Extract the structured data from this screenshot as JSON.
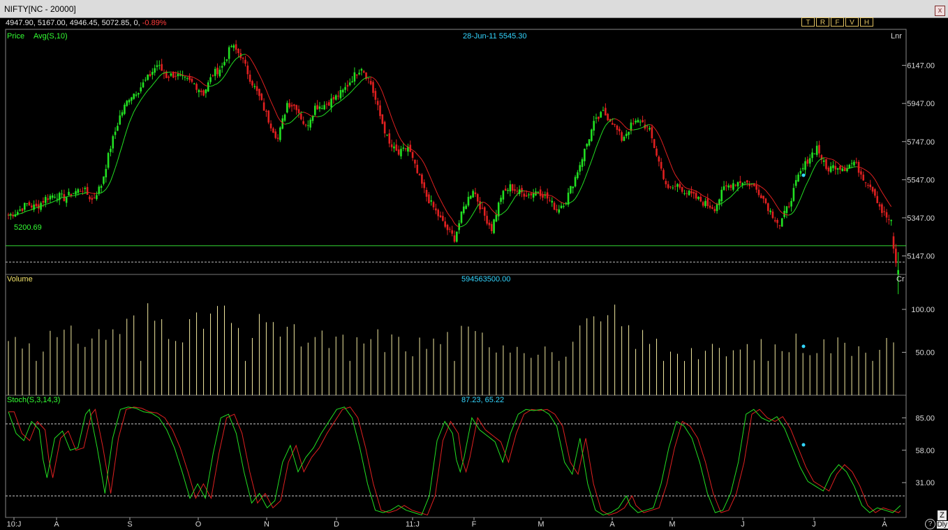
{
  "window": {
    "title": "NIFTY[NC - 20000]",
    "close_label": "x"
  },
  "quote": {
    "values": "4947.90, 5167.00, 4946.45, 5072.85, 0, ",
    "change": "-0.89%"
  },
  "toolbar": {
    "buttons": [
      "T",
      "R",
      "F",
      "V",
      "H"
    ]
  },
  "price_panel": {
    "label_price": "Price",
    "label_avg": "Avg(S,10)",
    "crosshair_readout": "28-Jun-11 5545.30",
    "scale_mode": "Lnr",
    "support_line_label": "5200.69"
  },
  "volume_panel": {
    "label": "Volume",
    "readout": "594563500.00",
    "unit": "Cr"
  },
  "stoch_panel": {
    "label": "Stoch(S,3,14,3)",
    "readout": "87.23, 65.22"
  },
  "misc": {
    "z_label": "Z",
    "dly_label": "Dly",
    "help_label": "?"
  },
  "colors": {
    "up": "#22e022",
    "down": "#e02020",
    "avg": "#22e022",
    "volume": "#f3eaa0",
    "stoch_k": "#22e022",
    "stoch_d": "#e02020"
  },
  "chart_data": [
    {
      "type": "candlestick",
      "title": "Price",
      "x_tick_labels": [
        "10:J",
        "A",
        "S",
        "O",
        "N",
        "D",
        "11:J",
        "F",
        "M",
        "A",
        "M",
        "J",
        "J",
        "A"
      ],
      "y_tick_labels": [
        "6147.00",
        "5947.00",
        "5747.00",
        "5547.00",
        "5347.00",
        "5147.00"
      ],
      "ylim": [
        5050,
        6270
      ],
      "support_level": 5200.69,
      "dashed_level": 5115,
      "close_path": [
        [
          0,
          5360
        ],
        [
          4,
          5380
        ],
        [
          8,
          5420
        ],
        [
          12,
          5400
        ],
        [
          16,
          5450
        ],
        [
          20,
          5470
        ],
        [
          24,
          5450
        ],
        [
          28,
          5480
        ],
        [
          32,
          5500
        ],
        [
          36,
          5440
        ],
        [
          40,
          5520
        ],
        [
          44,
          5720
        ],
        [
          48,
          5880
        ],
        [
          52,
          5980
        ],
        [
          56,
          6020
        ],
        [
          60,
          6080
        ],
        [
          64,
          6150
        ],
        [
          68,
          6090
        ],
        [
          72,
          6100
        ],
        [
          76,
          6070
        ],
        [
          80,
          6050
        ],
        [
          84,
          6000
        ],
        [
          88,
          6100
        ],
        [
          92,
          6140
        ],
        [
          96,
          6250
        ],
        [
          100,
          6200
        ],
        [
          104,
          6080
        ],
        [
          108,
          5980
        ],
        [
          112,
          5860
        ],
        [
          116,
          5760
        ],
        [
          120,
          5950
        ],
        [
          124,
          5930
        ],
        [
          128,
          5820
        ],
        [
          132,
          5930
        ],
        [
          136,
          5940
        ],
        [
          140,
          5970
        ],
        [
          144,
          6010
        ],
        [
          148,
          6080
        ],
        [
          152,
          6140
        ],
        [
          156,
          6050
        ],
        [
          160,
          5880
        ],
        [
          164,
          5730
        ],
        [
          168,
          5680
        ],
        [
          172,
          5720
        ],
        [
          176,
          5580
        ],
        [
          180,
          5460
        ],
        [
          184,
          5380
        ],
        [
          188,
          5300
        ],
        [
          192,
          5240
        ],
        [
          196,
          5400
        ],
        [
          200,
          5500
        ],
        [
          204,
          5380
        ],
        [
          208,
          5290
        ],
        [
          212,
          5460
        ],
        [
          216,
          5510
        ],
        [
          220,
          5480
        ],
        [
          224,
          5470
        ],
        [
          228,
          5490
        ],
        [
          232,
          5450
        ],
        [
          236,
          5390
        ],
        [
          240,
          5440
        ],
        [
          244,
          5560
        ],
        [
          248,
          5700
        ],
        [
          252,
          5840
        ],
        [
          256,
          5900
        ],
        [
          260,
          5850
        ],
        [
          264,
          5760
        ],
        [
          268,
          5830
        ],
        [
          272,
          5860
        ],
        [
          276,
          5800
        ],
        [
          280,
          5640
        ],
        [
          284,
          5490
        ],
        [
          288,
          5520
        ],
        [
          292,
          5480
        ],
        [
          296,
          5450
        ],
        [
          300,
          5420
        ],
        [
          304,
          5400
        ],
        [
          308,
          5500
        ],
        [
          312,
          5530
        ],
        [
          316,
          5540
        ],
        [
          320,
          5520
        ],
        [
          324,
          5470
        ],
        [
          328,
          5380
        ],
        [
          332,
          5310
        ],
        [
          336,
          5420
        ],
        [
          340,
          5560
        ],
        [
          344,
          5650
        ],
        [
          348,
          5720
        ],
        [
          352,
          5600
        ],
        [
          356,
          5620
        ],
        [
          360,
          5610
        ],
        [
          364,
          5640
        ],
        [
          368,
          5560
        ],
        [
          372,
          5500
        ],
        [
          376,
          5380
        ],
        [
          380,
          5320
        ]
      ],
      "last_bars": [
        {
          "open": 5250,
          "high": 5270,
          "low": 5160,
          "close": 5185
        },
        {
          "open": 5185,
          "high": 5210,
          "low": 5090,
          "close": 5110
        },
        {
          "open": 5050,
          "high": 5167.0,
          "low": 4946.45,
          "close": 5072.85
        }
      ]
    },
    {
      "type": "bar",
      "title": "Volume",
      "y_tick_labels": [
        "100.00",
        "50.00"
      ],
      "ylim": [
        0,
        135
      ],
      "volume_path": [
        [
          0,
          70
        ],
        [
          8,
          68
        ],
        [
          16,
          72
        ],
        [
          24,
          70
        ],
        [
          32,
          73
        ],
        [
          40,
          75
        ],
        [
          44,
          80
        ],
        [
          48,
          85
        ],
        [
          52,
          88
        ],
        [
          56,
          92
        ],
        [
          60,
          100
        ],
        [
          64,
          96
        ],
        [
          68,
          92
        ],
        [
          72,
          88
        ],
        [
          76,
          86
        ],
        [
          80,
          82
        ],
        [
          84,
          92
        ],
        [
          88,
          108
        ],
        [
          92,
          100
        ],
        [
          96,
          90
        ],
        [
          100,
          82
        ],
        [
          104,
          76
        ],
        [
          108,
          84
        ],
        [
          112,
          118
        ],
        [
          116,
          80
        ],
        [
          120,
          74
        ],
        [
          128,
          70
        ],
        [
          136,
          68
        ],
        [
          144,
          66
        ],
        [
          152,
          68
        ],
        [
          160,
          70
        ],
        [
          168,
          64
        ],
        [
          176,
          62
        ],
        [
          184,
          66
        ],
        [
          192,
          75
        ],
        [
          200,
          72
        ],
        [
          208,
          70
        ],
        [
          216,
          66
        ],
        [
          224,
          62
        ],
        [
          232,
          58
        ],
        [
          240,
          62
        ],
        [
          248,
          78
        ],
        [
          256,
          90
        ],
        [
          262,
          95
        ],
        [
          268,
          76
        ],
        [
          276,
          66
        ],
        [
          284,
          62
        ],
        [
          292,
          56
        ],
        [
          300,
          54
        ],
        [
          308,
          52
        ],
        [
          316,
          56
        ],
        [
          324,
          58
        ],
        [
          332,
          60
        ],
        [
          340,
          66
        ],
        [
          348,
          64
        ],
        [
          356,
          62
        ],
        [
          364,
          64
        ],
        [
          372,
          66
        ],
        [
          380,
          64
        ]
      ]
    },
    {
      "type": "line",
      "title": "Stoch(S,3,14,3)",
      "y_tick_labels": [
        "85.00",
        "58.00",
        "31.00"
      ],
      "ylim": [
        2,
        98
      ],
      "reference_levels": [
        80,
        20
      ],
      "series": [
        {
          "name": "%K",
          "values_path": [
            [
              0,
              90
            ],
            [
              4,
              72
            ],
            [
              8,
              66
            ],
            [
              12,
              82
            ],
            [
              16,
              75
            ],
            [
              18,
              50
            ],
            [
              20,
              35
            ],
            [
              24,
              68
            ],
            [
              28,
              74
            ],
            [
              32,
              58
            ],
            [
              36,
              60
            ],
            [
              40,
              88
            ],
            [
              42,
              92
            ],
            [
              46,
              60
            ],
            [
              50,
              22
            ],
            [
              54,
              68
            ],
            [
              58,
              92
            ],
            [
              62,
              94
            ],
            [
              66,
              93
            ],
            [
              70,
              90
            ],
            [
              74,
              89
            ],
            [
              78,
              85
            ],
            [
              82,
              75
            ],
            [
              86,
              60
            ],
            [
              90,
              40
            ],
            [
              94,
              18
            ],
            [
              98,
              30
            ],
            [
              102,
              18
            ],
            [
              106,
              55
            ],
            [
              110,
              85
            ],
            [
              114,
              88
            ],
            [
              118,
              72
            ],
            [
              122,
              40
            ],
            [
              126,
              14
            ],
            [
              130,
              22
            ],
            [
              134,
              10
            ],
            [
              138,
              16
            ],
            [
              142,
              48
            ],
            [
              146,
              62
            ],
            [
              150,
              40
            ],
            [
              154,
              52
            ],
            [
              158,
              60
            ],
            [
              162,
              72
            ],
            [
              166,
              82
            ],
            [
              170,
              92
            ],
            [
              174,
              94
            ],
            [
              178,
              85
            ],
            [
              182,
              60
            ],
            [
              186,
              30
            ],
            [
              190,
              8
            ],
            [
              194,
              6
            ],
            [
              198,
              8
            ],
            [
              202,
              12
            ],
            [
              206,
              8
            ],
            [
              210,
              6
            ],
            [
              214,
              4
            ],
            [
              218,
              20
            ],
            [
              222,
              66
            ],
            [
              226,
              82
            ],
            [
              230,
              72
            ],
            [
              232,
              50
            ],
            [
              234,
              40
            ],
            [
              236,
              52
            ],
            [
              240,
              85
            ],
            [
              244,
              75
            ],
            [
              248,
              70
            ],
            [
              252,
              65
            ],
            [
              256,
              48
            ],
            [
              260,
              72
            ],
            [
              264,
              88
            ],
            [
              268,
              92
            ],
            [
              272,
              91
            ],
            [
              276,
              92
            ],
            [
              280,
              88
            ],
            [
              284,
              78
            ],
            [
              288,
              48
            ],
            [
              292,
              38
            ],
            [
              296,
              68
            ],
            [
              300,
              30
            ],
            [
              304,
              8
            ],
            [
              308,
              4
            ],
            [
              312,
              6
            ],
            [
              316,
              10
            ],
            [
              320,
              20
            ],
            [
              322,
              12
            ],
            [
              326,
              6
            ],
            [
              330,
              8
            ],
            [
              334,
              10
            ],
            [
              338,
              30
            ],
            [
              342,
              60
            ],
            [
              346,
              82
            ],
            [
              350,
              78
            ],
            [
              354,
              68
            ],
            [
              358,
              48
            ],
            [
              362,
              22
            ],
            [
              366,
              6
            ],
            [
              370,
              8
            ],
            [
              374,
              22
            ],
            [
              378,
              48
            ],
            [
              382,
              88
            ],
            [
              386,
              92
            ],
            [
              390,
              85
            ],
            [
              394,
              82
            ],
            [
              398,
              86
            ],
            [
              402,
              76
            ],
            [
              406,
              60
            ],
            [
              410,
              44
            ],
            [
              414,
              32
            ],
            [
              418,
              28
            ],
            [
              422,
              24
            ],
            [
              426,
              38
            ],
            [
              430,
              46
            ],
            [
              434,
              40
            ],
            [
              438,
              28
            ],
            [
              442,
              12
            ],
            [
              446,
              6
            ],
            [
              450,
              10
            ],
            [
              454,
              8
            ],
            [
              458,
              6
            ],
            [
              462,
              12
            ]
          ]
        }
      ]
    }
  ]
}
